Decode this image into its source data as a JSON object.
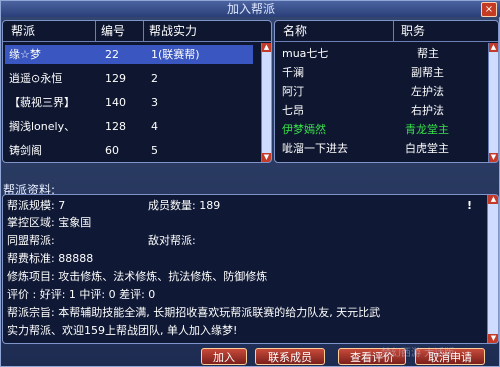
{
  "window": {
    "title": "加入帮派",
    "close": "×"
  },
  "gang_list": {
    "columns": [
      "帮派",
      "编号",
      "帮战实力"
    ],
    "rows": [
      {
        "name": "缘☆梦",
        "id": "22",
        "power": "1(联赛帮)"
      },
      {
        "name": "逍遥⊙永恒",
        "id": "129",
        "power": "2"
      },
      {
        "name": "【藐视三界】",
        "id": "140",
        "power": "3"
      },
      {
        "name": "搁浅lonely、",
        "id": "128",
        "power": "4"
      },
      {
        "name": "铸剑阁",
        "id": "60",
        "power": "5"
      }
    ]
  },
  "member_list": {
    "columns": [
      "名称",
      "职务"
    ],
    "rows": [
      {
        "name": "mua七七",
        "role": "帮主"
      },
      {
        "name": "千澜",
        "role": "副帮主"
      },
      {
        "name": "阿汀",
        "role": "左护法"
      },
      {
        "name": "七昂",
        "role": "右护法"
      },
      {
        "name": "伊梦嫣然",
        "role": "青龙堂主"
      },
      {
        "name": "呲溜一下进去",
        "role": "白虎堂主"
      }
    ]
  },
  "info": {
    "label": "帮派资料:",
    "scale_label": "帮派规模: 7",
    "members_label": "成员数量: 189",
    "territory": "掌控区域: 宝象国",
    "ally": "同盟帮派:",
    "enemy": "敌对帮派:",
    "fee": "帮费标准: 88888",
    "skills": "修炼项目: 攻击修炼、法术修炼、抗法修炼、防御修炼",
    "rating": "评价  : 好评: 1  中评: 0  差评: 0",
    "motto_1": "帮派宗旨: 本帮辅助技能全满, 长期招收喜欢玩帮派联赛的给力队友, 天元比武",
    "motto_2": "实力帮派、欢迎159上帮战团队, 单人加入缘梦!",
    "mark": "!"
  },
  "buttons": {
    "join": "加入",
    "contact": "联系成员",
    "view_rating": "查看评价",
    "cancel": "取消申请"
  },
  "watermark": "梦幻西游 大话版"
}
